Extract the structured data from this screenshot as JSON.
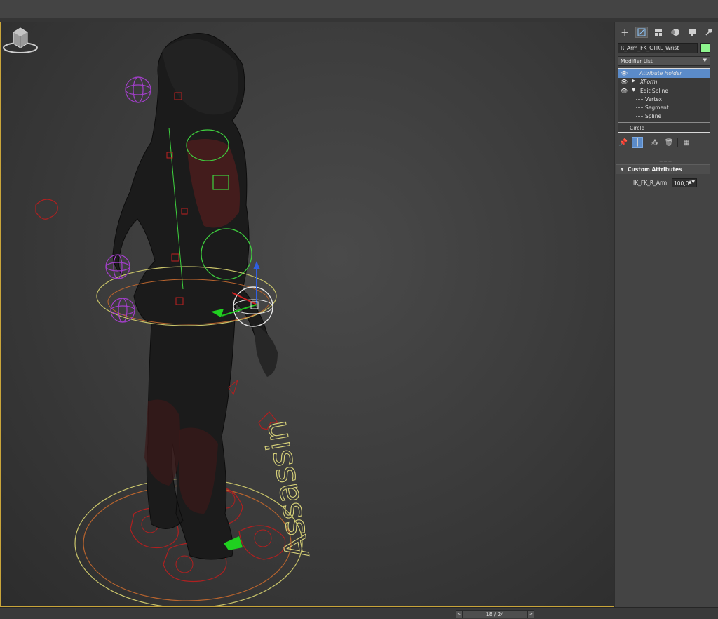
{
  "object_name": "R_Arm_FK_CTRL_Wrist",
  "object_color": "#8ef58e",
  "modifier_list_label": "Modifier List",
  "modifier_stack": [
    {
      "label": "Attribute Holder",
      "selected": true,
      "italic": true
    },
    {
      "label": "XForm",
      "italic": true
    },
    {
      "label": "Edit Spline",
      "expanded": true
    },
    {
      "label": "Vertex",
      "sub": true
    },
    {
      "label": "Segment",
      "sub": true
    },
    {
      "label": "Spline",
      "sub": true
    }
  ],
  "base_object": "Circle",
  "rollout_title": "Custom Attributes",
  "attribute": {
    "label": "IK_FK_R_Arm:",
    "value": "100,0"
  },
  "viewport_text": "Assassin",
  "time_slider": {
    "label": "18 / 24",
    "prev": "<",
    "next": ">"
  },
  "icons": {
    "create": "plus-icon",
    "modify": "modify-icon",
    "hierarchy": "hierarchy-icon",
    "motion": "motion-icon",
    "display": "display-icon",
    "utilities": "wrench-icon"
  },
  "accent_selection": "#5b8bc9",
  "viewport_border": "#c9a53a"
}
